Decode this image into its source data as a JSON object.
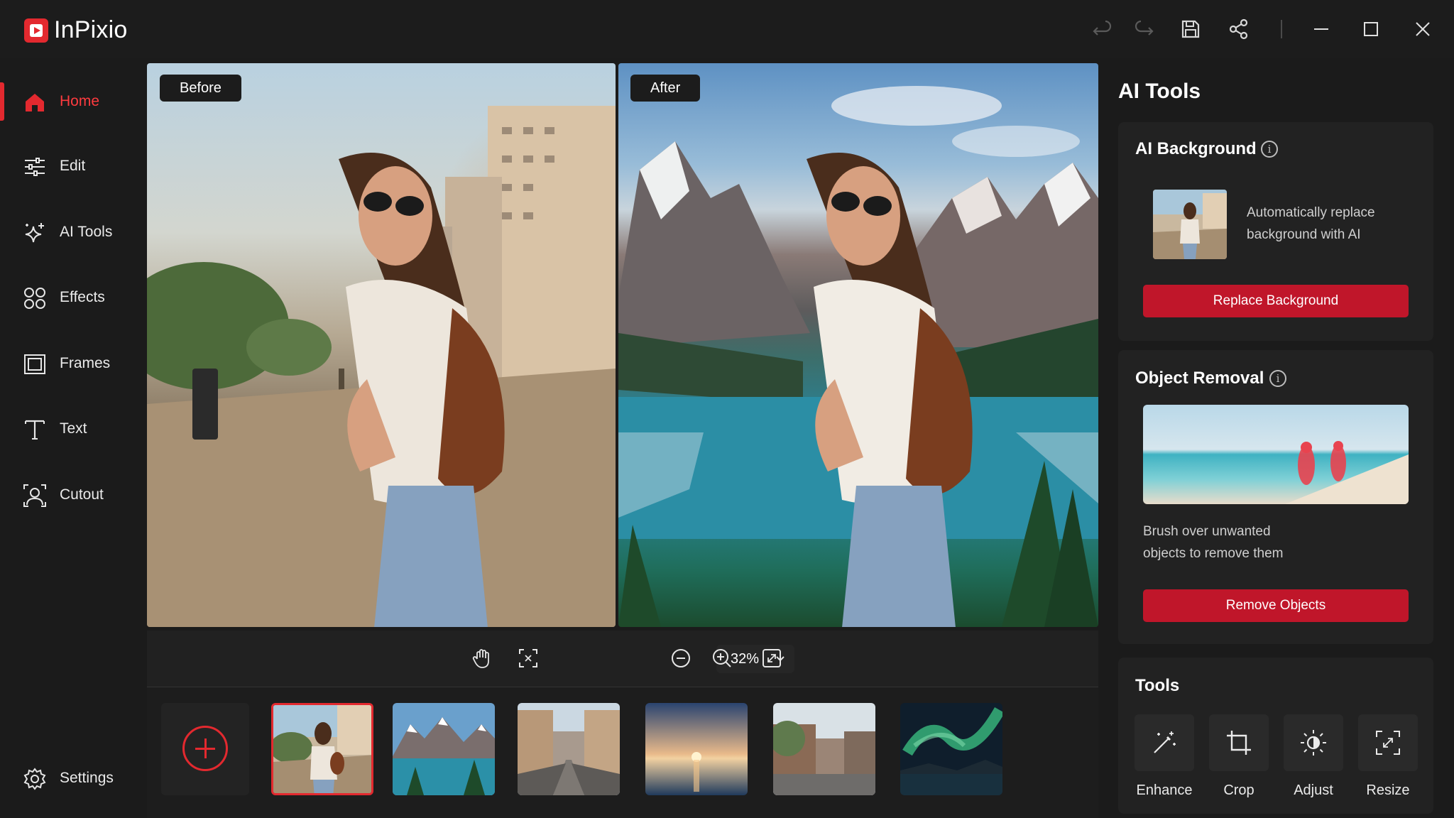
{
  "app": {
    "name": "InPixio"
  },
  "titlebar": {
    "icons": [
      "undo-icon",
      "redo-icon",
      "save-icon",
      "share-icon",
      "minimize-icon",
      "maximize-icon",
      "close-icon"
    ]
  },
  "sidebar": {
    "items": [
      {
        "label": "Home",
        "icon": "home-icon",
        "active": true
      },
      {
        "label": "Edit",
        "icon": "sliders-icon"
      },
      {
        "label": "AI Tools",
        "icon": "sparkles-icon"
      },
      {
        "label": "Effects",
        "icon": "effects-icon"
      },
      {
        "label": "Frames",
        "icon": "frame-icon"
      },
      {
        "label": "Text",
        "icon": "text-icon"
      },
      {
        "label": "Cutout",
        "icon": "cutout-icon"
      }
    ],
    "settings_label": "Settings"
  },
  "preview": {
    "before_label": "Before",
    "after_label": "After"
  },
  "zoombar": {
    "zoom": "32%",
    "icons": [
      "hand-icon",
      "fit-screen-icon",
      "zoom-out-icon",
      "zoom-in-icon",
      "actual-size-icon"
    ]
  },
  "thumbnails": [
    {
      "name": "woman-street",
      "selected": true
    },
    {
      "name": "mountain-lake"
    },
    {
      "name": "city-street"
    },
    {
      "name": "sunset-sea"
    },
    {
      "name": "town-street"
    },
    {
      "name": "aurora"
    }
  ],
  "panel": {
    "title": "AI Tools",
    "ai_background": {
      "title": "AI Background",
      "description": "Automatically replace background with AI",
      "description_line1": "Automatically replace",
      "description_line2": "background with AI",
      "button": "Replace Background"
    },
    "object_removal": {
      "title": "Object Removal",
      "description_line1": "Brush over unwanted",
      "description_line2": "objects to remove them",
      "button": "Remove Objects"
    },
    "tools": {
      "title": "Tools",
      "items": [
        {
          "label": "Enhance",
          "icon": "magic-wand-icon"
        },
        {
          "label": "Crop",
          "icon": "crop-icon"
        },
        {
          "label": "Adjust",
          "icon": "brightness-icon"
        },
        {
          "label": "Resize",
          "icon": "resize-icon"
        }
      ]
    }
  },
  "colors": {
    "accent": "#e3292f",
    "button": "#c0162a",
    "background": "#1b1b1b",
    "card": "#222222"
  }
}
